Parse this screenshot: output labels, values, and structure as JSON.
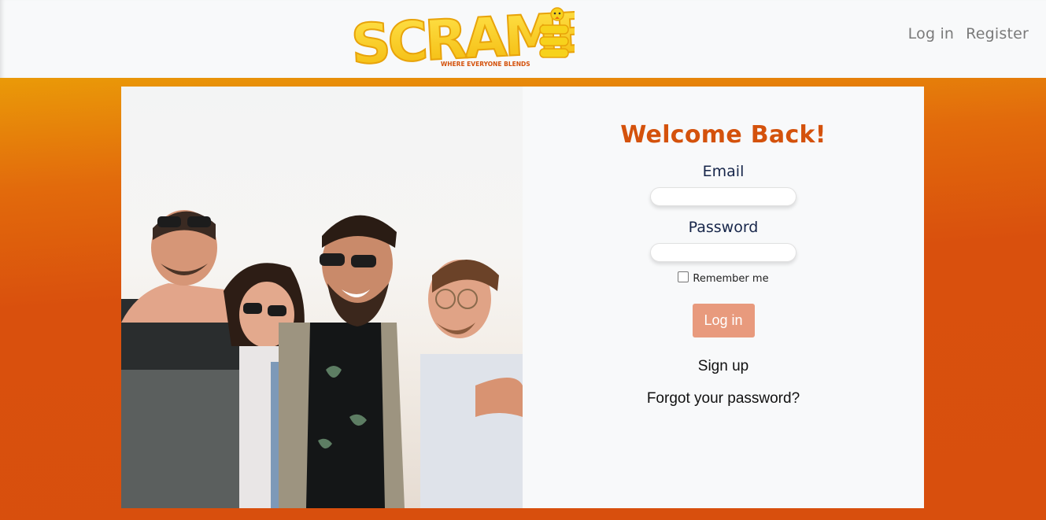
{
  "navbar": {
    "logo_text": "SCRAMBLE",
    "logo_tagline": "WHERE EVERYONE BLENDS",
    "login_link": "Log in",
    "register_link": "Register"
  },
  "login": {
    "title": "Welcome Back!",
    "email_label": "Email",
    "email_value": "",
    "password_label": "Password",
    "password_value": "",
    "remember_label": "Remember me",
    "remember_checked": false,
    "submit_label": "Log in",
    "signup_link": "Sign up",
    "forgot_link": "Forgot your password?"
  },
  "photo": {
    "description_icon": "group-of-friends-photo"
  },
  "colors": {
    "brand_orange": "#d4520c",
    "background_gradient_top": "#ea9a08",
    "background_gradient_bottom": "#d84f0d",
    "button": "#e89a7d",
    "label": "#17264a",
    "logo_yellow": "#f7d21c"
  }
}
